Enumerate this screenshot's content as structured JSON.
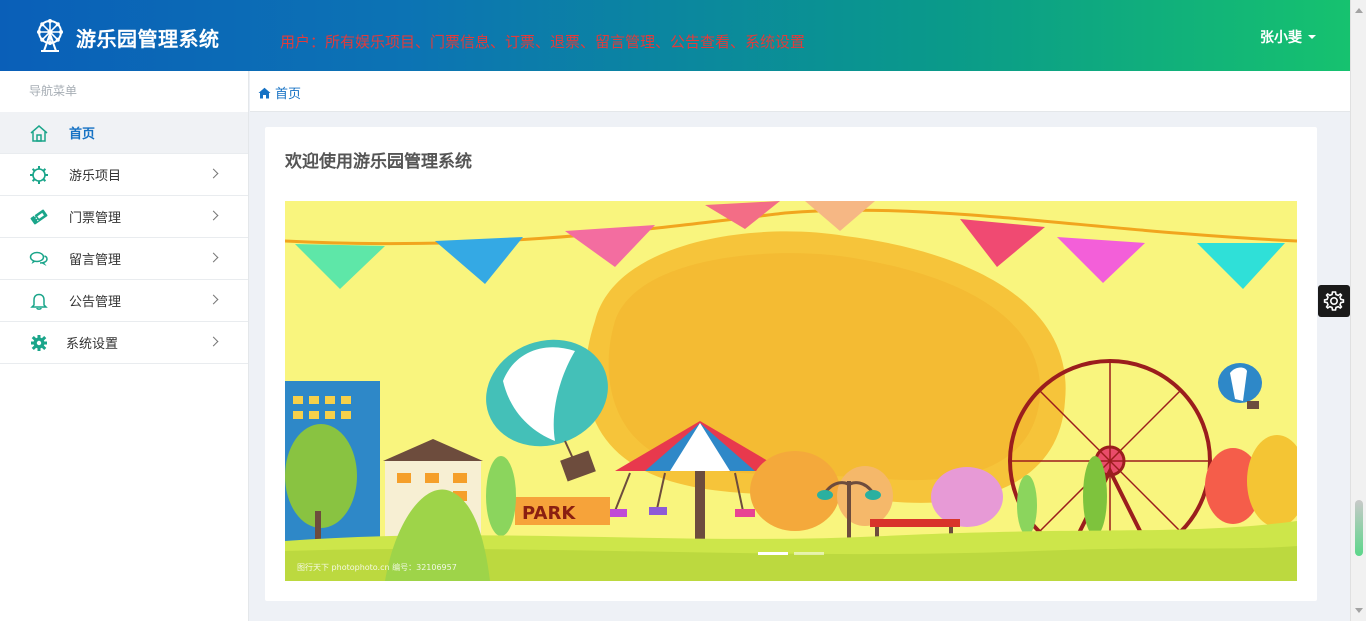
{
  "header": {
    "title": "游乐园管理系统",
    "user_description": "用户：所有娱乐项目、门票信息、订票、退票、留言管理、公告查看、系统设置",
    "user_name": "张小斐"
  },
  "sidebar": {
    "caption": "导航菜单",
    "items": [
      {
        "label": "首页",
        "icon": "home-icon",
        "active": true
      },
      {
        "label": "游乐项目",
        "icon": "gear-ring-icon"
      },
      {
        "label": "门票管理",
        "icon": "ticket-icon"
      },
      {
        "label": "留言管理",
        "icon": "comments-icon"
      },
      {
        "label": "公告管理",
        "icon": "bell-icon"
      },
      {
        "label": "系统设置",
        "icon": "cog-icon"
      }
    ]
  },
  "breadcrumb": {
    "home": "首页"
  },
  "main": {
    "title": "欢迎使用游乐园管理系统",
    "banner": {
      "sign_text": "PARK",
      "watermark": "图行天下 photophoto.cn 编号：32106957",
      "carousel_indicators": 2,
      "active_indicator": 0
    }
  },
  "colors": {
    "header_gradient_start": "#0a5fb8",
    "header_gradient_end": "#16c26f",
    "user_description": "#e23b3b",
    "accent": "#1672c4",
    "icon_teal": "#1aa58a",
    "banner_bg": "#f9f57e"
  }
}
